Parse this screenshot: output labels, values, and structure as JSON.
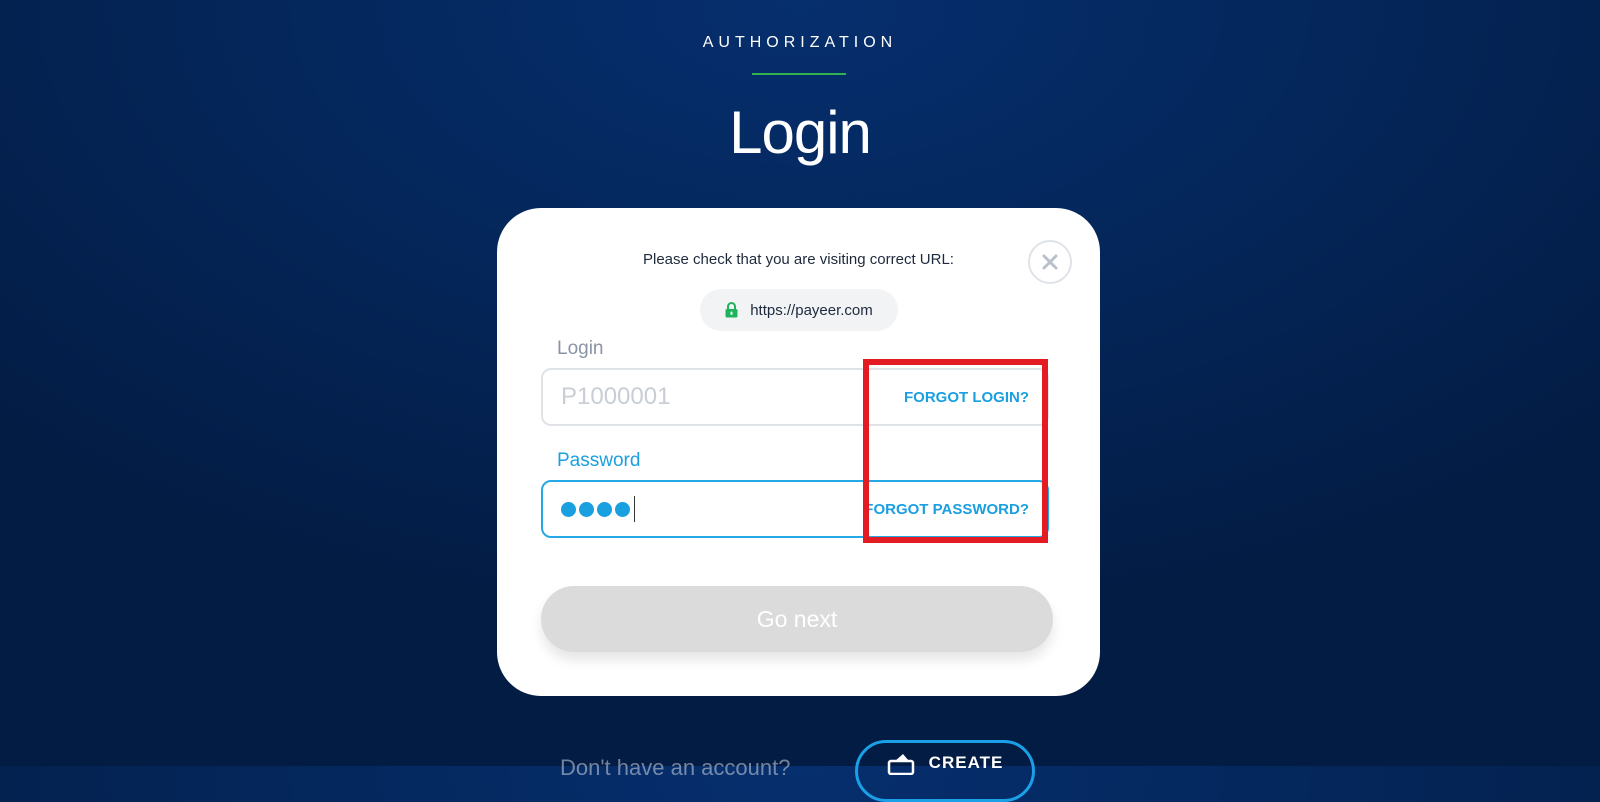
{
  "header": {
    "section_label": "AUTHORIZATION",
    "title": "Login"
  },
  "card": {
    "url_notice": "Please check that you are visiting correct URL:",
    "url": "https://payeer.com",
    "login": {
      "label": "Login",
      "placeholder": "P1000001",
      "value": "",
      "forgot_label": "FORGOT LOGIN?"
    },
    "password": {
      "label": "Password",
      "masked_length": 4,
      "forgot_label": "FORGOT PASSWORD?"
    },
    "submit_label": "Go next"
  },
  "footer": {
    "prompt": "Don't have an account?",
    "create_label": "CREATE"
  },
  "icons": {
    "close": "close-icon",
    "lock": "lock-icon",
    "create": "create-account-icon"
  },
  "colors": {
    "accent": "#1a9fe0",
    "underline": "#2fb34f",
    "highlight": "#e31b23",
    "lock": "#1fb35c",
    "disabled_button": "#dbdbdb"
  }
}
